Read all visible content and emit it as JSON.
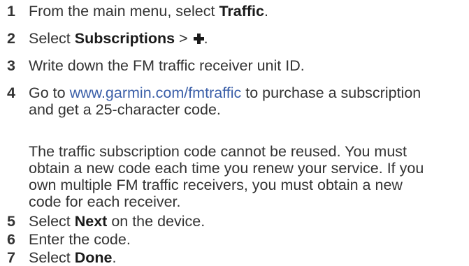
{
  "steps": [
    {
      "num": "1",
      "pre": "From the main menu, select ",
      "bold": "Traffic",
      "post": "."
    },
    {
      "num": "2",
      "pre": "Select ",
      "bold": "Subscriptions",
      "post": " > ",
      "icon": "plus-icon",
      "post2": "."
    },
    {
      "num": "3",
      "text": "Write down the FM traffic receiver unit ID."
    },
    {
      "num": "4",
      "pre": "Go to ",
      "link": "www.garmin.com/fmtraffic",
      "post": " to purchase a subscription",
      "line2": "and get a 25-character code."
    },
    {
      "num": "5",
      "pre": "Select ",
      "bold": "Next",
      "post": " on the device."
    },
    {
      "num": "6",
      "text": "Enter the code."
    },
    {
      "num": "7",
      "pre": "Select ",
      "bold": "Done",
      "post": "."
    }
  ],
  "note": {
    "line1": "The traffic subscription code cannot be reused. You must",
    "line2": "obtain a new code each time you renew your service. If you",
    "line3": "own multiple FM traffic receivers, you must obtain a new",
    "line4": "code for each receiver."
  },
  "colors": {
    "text": "#333333",
    "link": "#3b5fa8"
  }
}
